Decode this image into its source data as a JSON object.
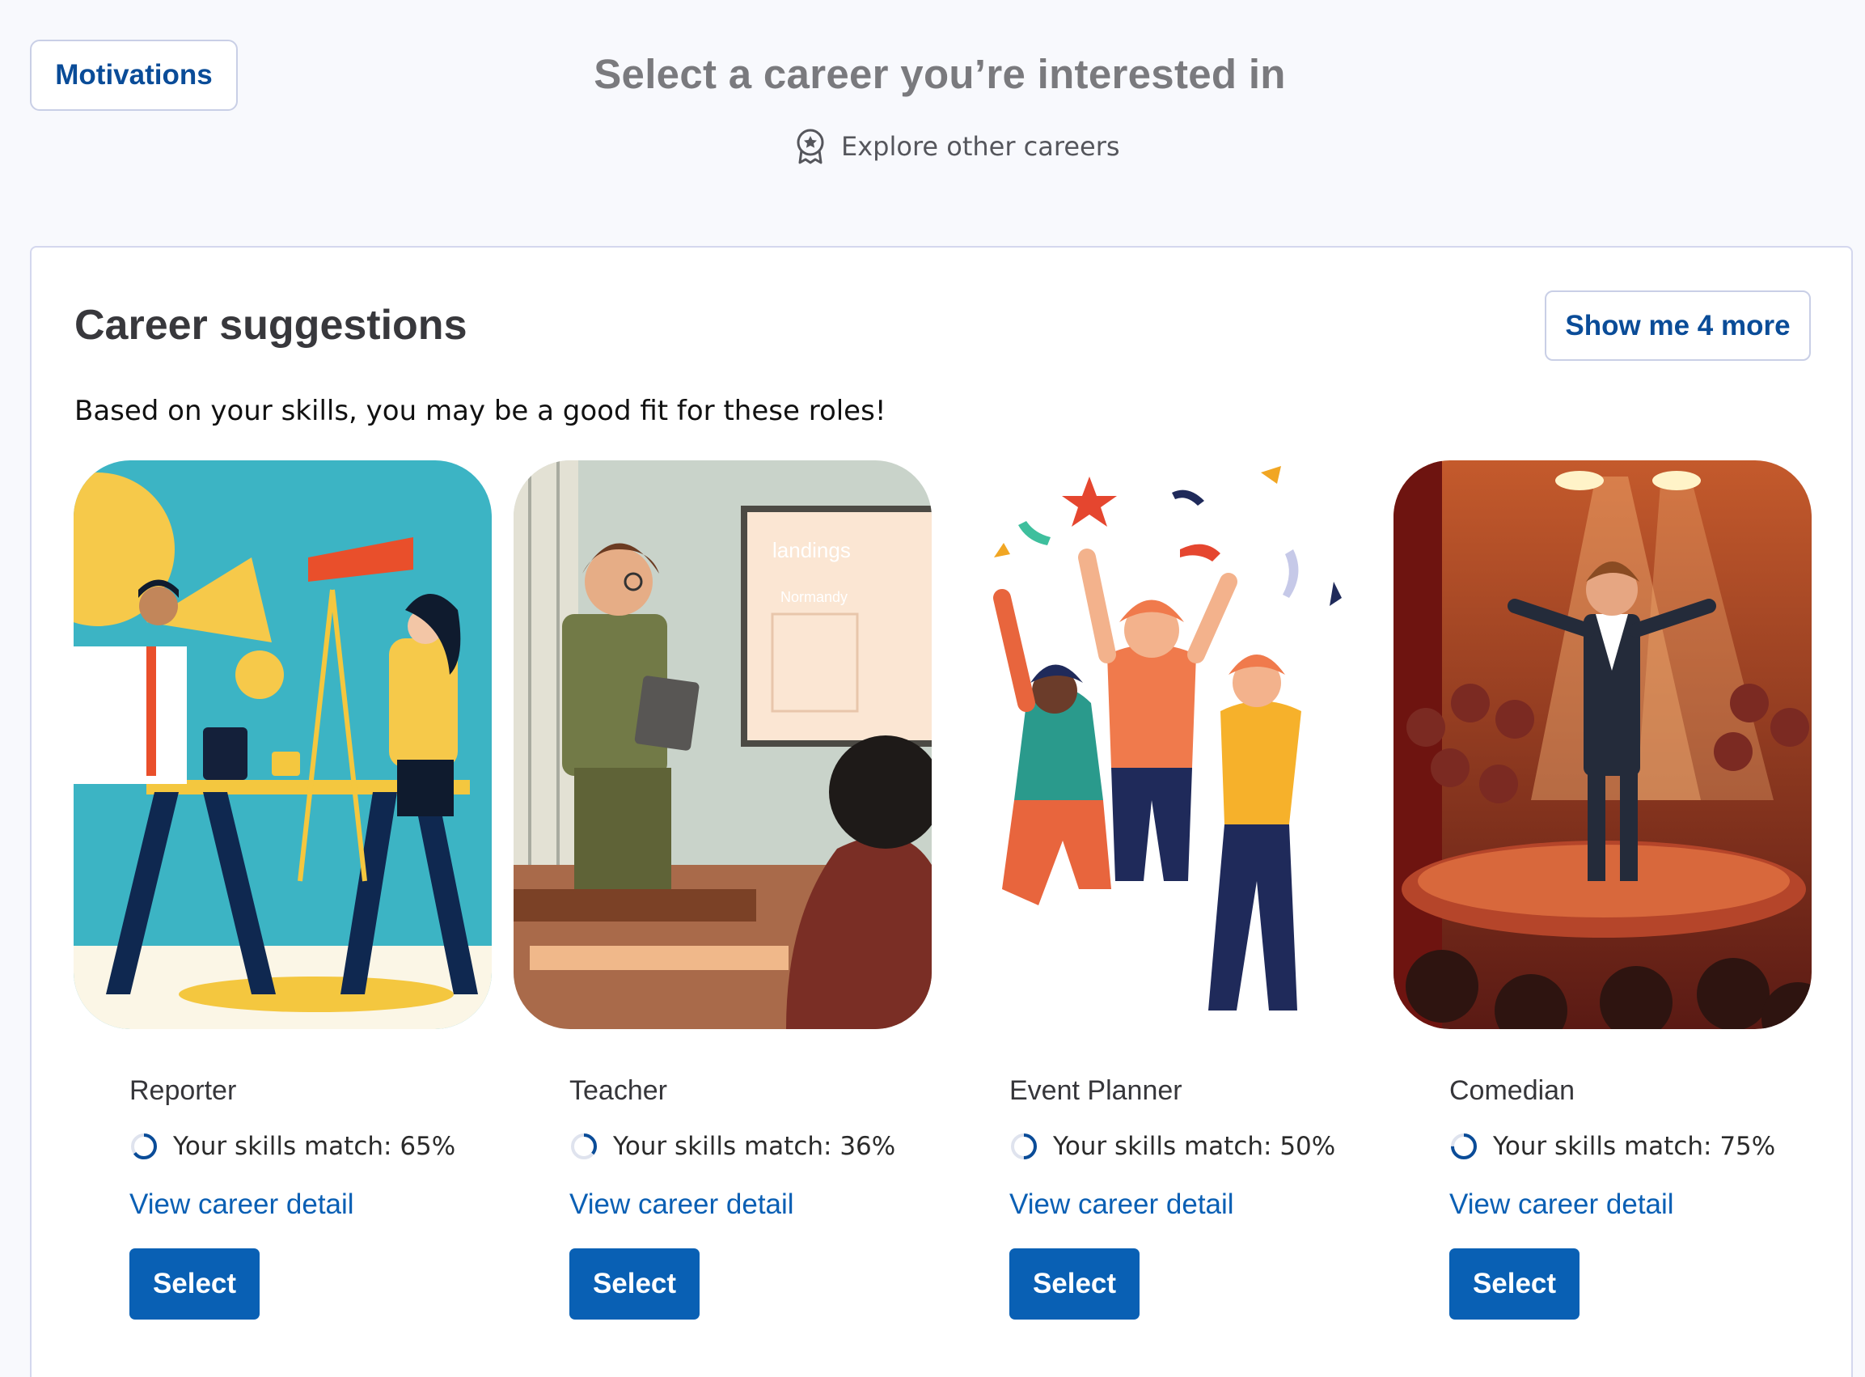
{
  "header": {
    "motivations_label": "Motivations",
    "title": "Select a career you’re interested in",
    "explore_label": "Explore other careers"
  },
  "suggestions": {
    "title": "Career suggestions",
    "show_more_label": "Show me 4 more",
    "subtitle": "Based on your skills, you may be a good fit for these roles!",
    "careers": [
      {
        "name": "Reporter",
        "match_label": "Your skills match: 65%",
        "match_value": 0.65,
        "detail_label": "View career detail",
        "select_label": "Select",
        "image_icon": "reporter-illustration"
      },
      {
        "name": "Teacher",
        "match_label": "Your skills match: 36%",
        "match_value": 0.36,
        "detail_label": "View career detail",
        "select_label": "Select",
        "image_icon": "teacher-illustration",
        "image_board_title": "landings",
        "image_board_subtitle": "Normandy"
      },
      {
        "name": "Event Planner",
        "match_label": "Your skills match: 50%",
        "match_value": 0.5,
        "detail_label": "View career detail",
        "select_label": "Select",
        "image_icon": "party-illustration"
      },
      {
        "name": "Comedian",
        "match_label": "Your skills match: 75%",
        "match_value": 0.75,
        "detail_label": "View career detail",
        "select_label": "Select",
        "image_icon": "comedian-illustration"
      }
    ]
  },
  "colors": {
    "brand_blue": "#0a4c98",
    "button_blue": "#0960b4",
    "link_blue": "#0a5fb4",
    "ring_track": "#dfe3ee",
    "page_bg": "#f8f9fd"
  }
}
